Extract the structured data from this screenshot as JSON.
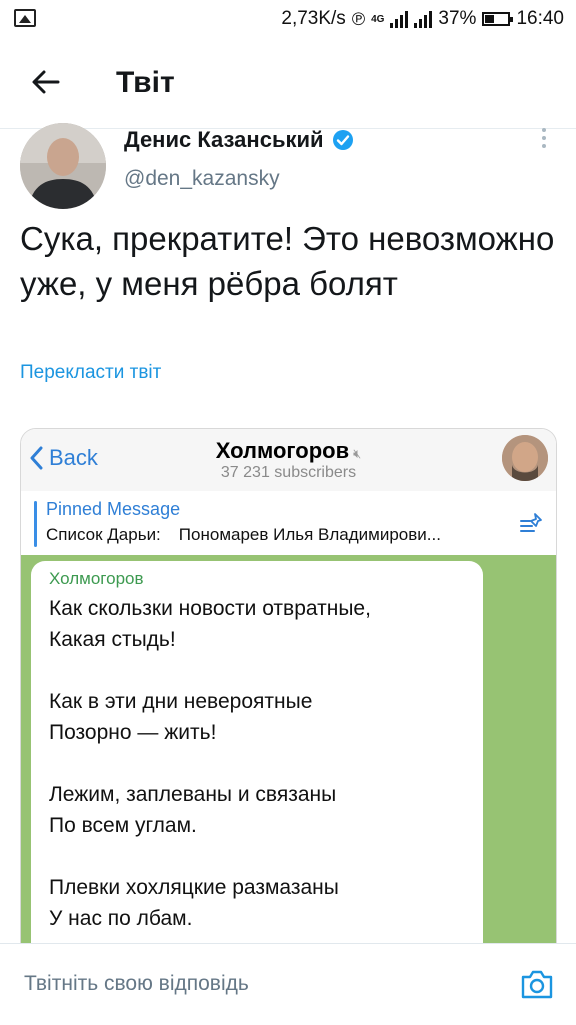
{
  "status_bar": {
    "speed": "2,73K/s",
    "network": "4G",
    "battery": "37%",
    "time": "16:40"
  },
  "header": {
    "title": "Твіт"
  },
  "tweet": {
    "author_name": "Денис Казанський",
    "handle": "@den_kazansky",
    "text": "Сука, прекратите! Это невозможно уже, у меня рёбра болят",
    "translate_label": "Перекласти твіт"
  },
  "telegram": {
    "back_label": "Back",
    "channel_title": "Холмогоров",
    "subscribers": "37 231 subscribers",
    "pinned_title": "Pinned Message",
    "pinned_text_a": "Список Дарьи:",
    "pinned_text_b": "Пономарев Илья Владимирови...",
    "message_author": "Холмогоров",
    "message_lines": [
      "Как скользки новости отвратные,",
      "Какая стыдь!",
      "Как в эти дни невероятные",
      "Позорно — жить!",
      "Лежим, заплеваны и связаны",
      "По всем углам.",
      "Плевки хохляцкие размазаны",
      "У нас по лбам."
    ]
  },
  "reply": {
    "placeholder": "Твітніть свою відповідь"
  },
  "colors": {
    "accent": "#1b95e0",
    "chat_bg": "#97c373",
    "tg_blue": "#2f7fd6"
  }
}
